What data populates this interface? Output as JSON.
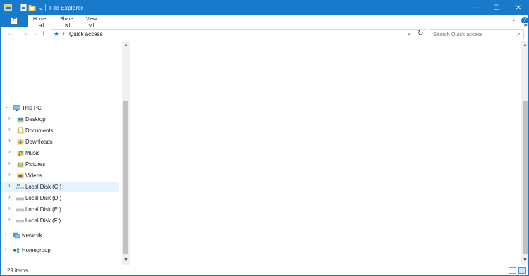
{
  "window": {
    "title": "File Explorer",
    "accent": "#1979ca",
    "controls": {
      "minimize": "—",
      "maximize": "☐",
      "close": "✕"
    }
  },
  "ribbon": {
    "file_key": "F",
    "tabs": [
      {
        "label": "Home",
        "key": "H"
      },
      {
        "label": "Share",
        "key": "S"
      },
      {
        "label": "View",
        "key": "V"
      }
    ],
    "expand_glyph": "⌄",
    "help_glyph": "?",
    "help_key": "E"
  },
  "addressbar": {
    "back": "←",
    "forward": "→",
    "recent": "⌄",
    "up": "↑",
    "separator": "›",
    "location": "Quick access",
    "dropdown": "⌄",
    "refresh": "↻"
  },
  "search": {
    "placeholder": "Search Quick access",
    "icon": "⌕"
  },
  "navigation": {
    "expand_glyph": "›",
    "collapse_glyph": "⌄",
    "items": [
      {
        "label": "This PC",
        "icon": "computer-icon",
        "expanded": true
      },
      {
        "label": "Desktop",
        "icon": "desktop-folder-icon"
      },
      {
        "label": "Documents",
        "icon": "documents-folder-icon"
      },
      {
        "label": "Downloads",
        "icon": "downloads-folder-icon"
      },
      {
        "label": "Music",
        "icon": "music-folder-icon"
      },
      {
        "label": "Pictures",
        "icon": "pictures-folder-icon"
      },
      {
        "label": "Videos",
        "icon": "videos-folder-icon"
      },
      {
        "label": "Local Disk (C:)",
        "icon": "system-drive-icon",
        "selected": true
      },
      {
        "label": "Local Disk (D:)",
        "icon": "drive-icon"
      },
      {
        "label": "Local Disk (E:)",
        "icon": "drive-icon"
      },
      {
        "label": "Local Disk (F:)",
        "icon": "drive-icon"
      },
      {
        "label": "Network",
        "icon": "network-icon"
      },
      {
        "label": "Homegroup",
        "icon": "homegroup-icon"
      }
    ]
  },
  "scrollbar": {
    "up": "▲",
    "down": "▼"
  },
  "status": {
    "item_count": "29 items"
  }
}
